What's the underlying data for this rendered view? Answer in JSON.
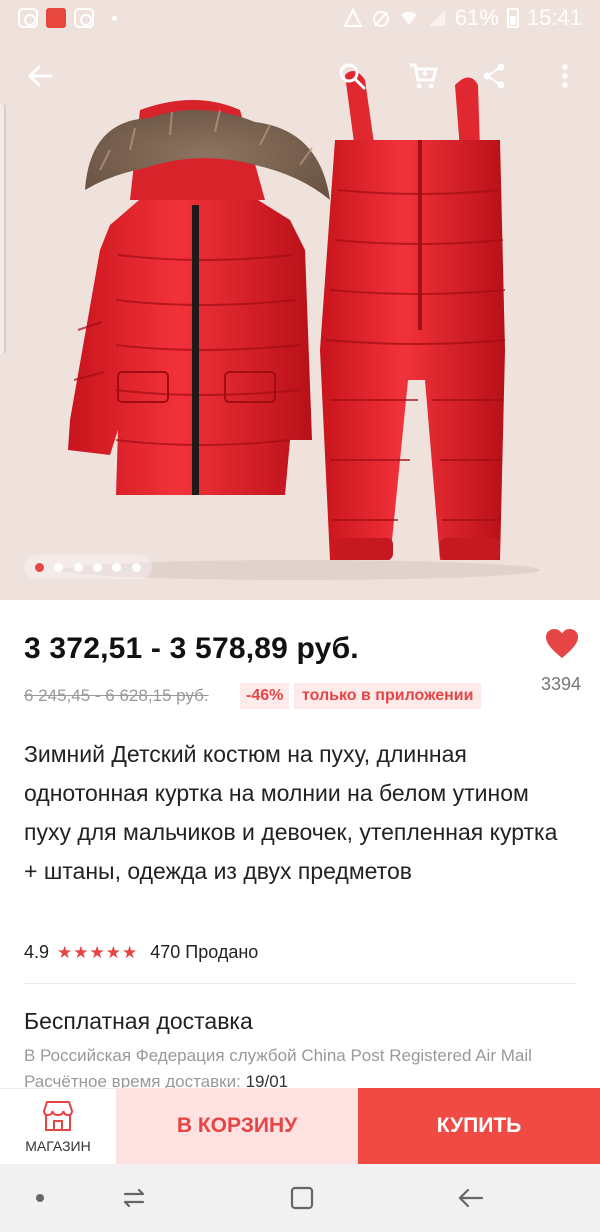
{
  "statusbar": {
    "battery": "61%",
    "time": "15:41",
    "icons": [
      "instagram-icon",
      "aliexpress-icon",
      "instagram-icon",
      "dot-icon",
      "data-saver-icon",
      "no-signal-icon",
      "wifi-icon",
      "signal-icon",
      "battery-icon"
    ]
  },
  "topbar": {
    "icons": [
      "back-arrow-icon",
      "search-icon",
      "cart-icon",
      "share-icon",
      "more-vertical-icon"
    ]
  },
  "carousel": {
    "total": 6,
    "active": 0
  },
  "product": {
    "price": "3 372,51 - 3 578,89 руб.",
    "old_price": "6 245,45 - 6 628,15 руб.",
    "discount": "-46%",
    "app_only": "только в приложении",
    "wish_count": "3394",
    "title": "Зимний Детский костюм на пуху, длинная однотонная куртка на молнии на белом утином пуху для мальчиков и девочек, утепленная куртка + штаны, одежда из двух предметов",
    "rating": "4.9",
    "stars": "★★★★★",
    "sold": "470 Продано"
  },
  "shipping": {
    "title": "Бесплатная доставка",
    "desc": "В Российская Федерация службой China Post Registered Air Mail",
    "time_label": "Расчётное время доставки:",
    "time_value": "19/01"
  },
  "actions": {
    "store": "МАГАЗИН",
    "add_to_cart": "В КОРЗИНУ",
    "buy": "КУПИТЬ"
  },
  "colors": {
    "accent": "#e64545",
    "buy_bg": "#f04a45",
    "cart_bg": "#fde2e1",
    "hero_bg": "#efe1dc"
  }
}
